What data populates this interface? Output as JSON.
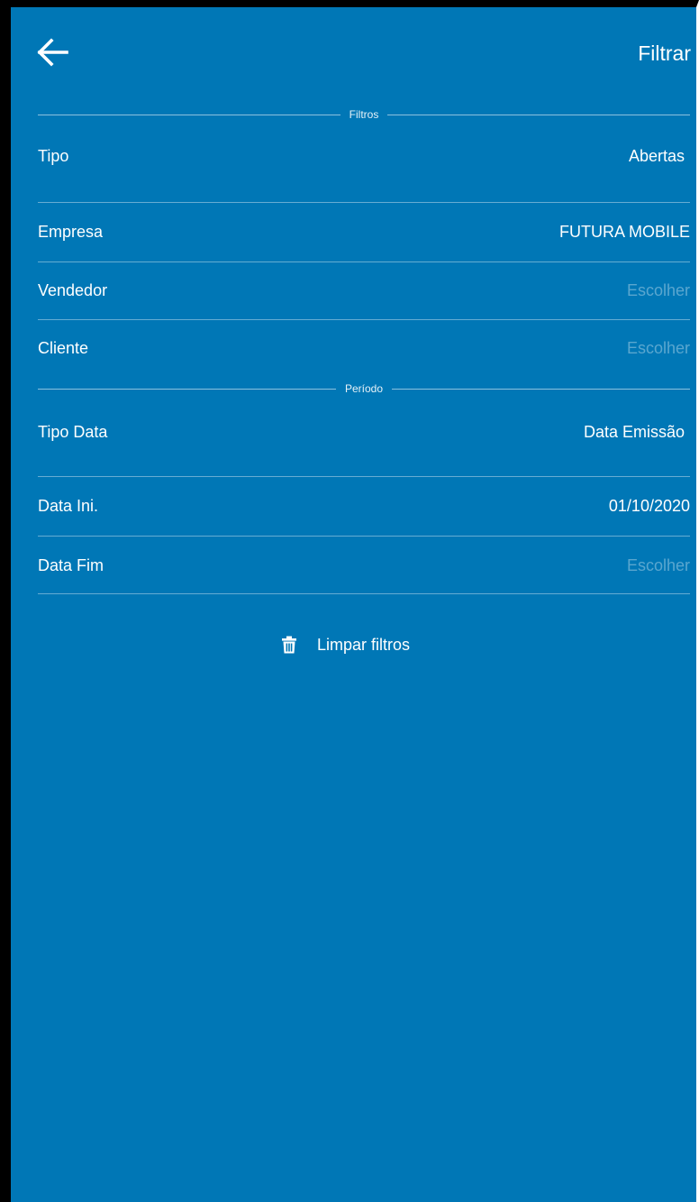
{
  "header": {
    "back_icon": "arrow-left-icon",
    "action_label": "Filtrar"
  },
  "sections": {
    "filtros": "Filtros",
    "periodo": "Período"
  },
  "rows": {
    "tipo": {
      "label": "Tipo",
      "value": "Abertas"
    },
    "empresa": {
      "label": "Empresa",
      "value": "FUTURA MOBILE"
    },
    "vendedor": {
      "label": "Vendedor",
      "value": "Escolher"
    },
    "cliente": {
      "label": "Cliente",
      "value": "Escolher"
    },
    "tipo_data": {
      "label": "Tipo Data",
      "value": "Data Emissão"
    },
    "data_ini": {
      "label": "Data Ini.",
      "value": "01/10/2020"
    },
    "data_fim": {
      "label": "Data Fim",
      "value": "Escolher"
    }
  },
  "clear": {
    "icon": "trash-icon",
    "label": "Limpar filtros"
  },
  "colors": {
    "background": "#0077b6",
    "text": "#ffffff",
    "placeholder": "rgba(255,255,255,0.35)"
  }
}
